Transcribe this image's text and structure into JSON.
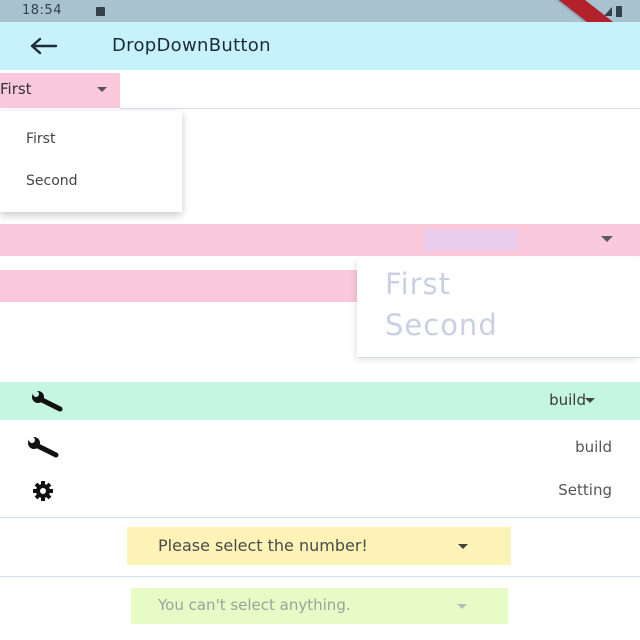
{
  "status_bar": {
    "time": "18:54"
  },
  "app_bar": {
    "title": "DropDownButton"
  },
  "dropdown_first": {
    "selected": "First"
  },
  "popup_menu_small": {
    "items": [
      "First",
      "Second"
    ]
  },
  "popup_menu_large": {
    "items": [
      "First",
      "Second"
    ]
  },
  "icon_dropdown": {
    "selected": "build",
    "items": [
      {
        "icon": "wrench-icon",
        "label": "build"
      },
      {
        "icon": "gear-icon",
        "label": "Setting"
      }
    ]
  },
  "hint_dropdown": {
    "hint": "Please select the number!"
  },
  "disabled_dropdown": {
    "hint": "You can't select anything."
  },
  "colors": {
    "app_bar": "#c7f2fb",
    "pink": "#fbc9dc",
    "green": "#c4f6e1",
    "yellow": "#fdf3b6",
    "light_green": "#e6fbc6"
  }
}
